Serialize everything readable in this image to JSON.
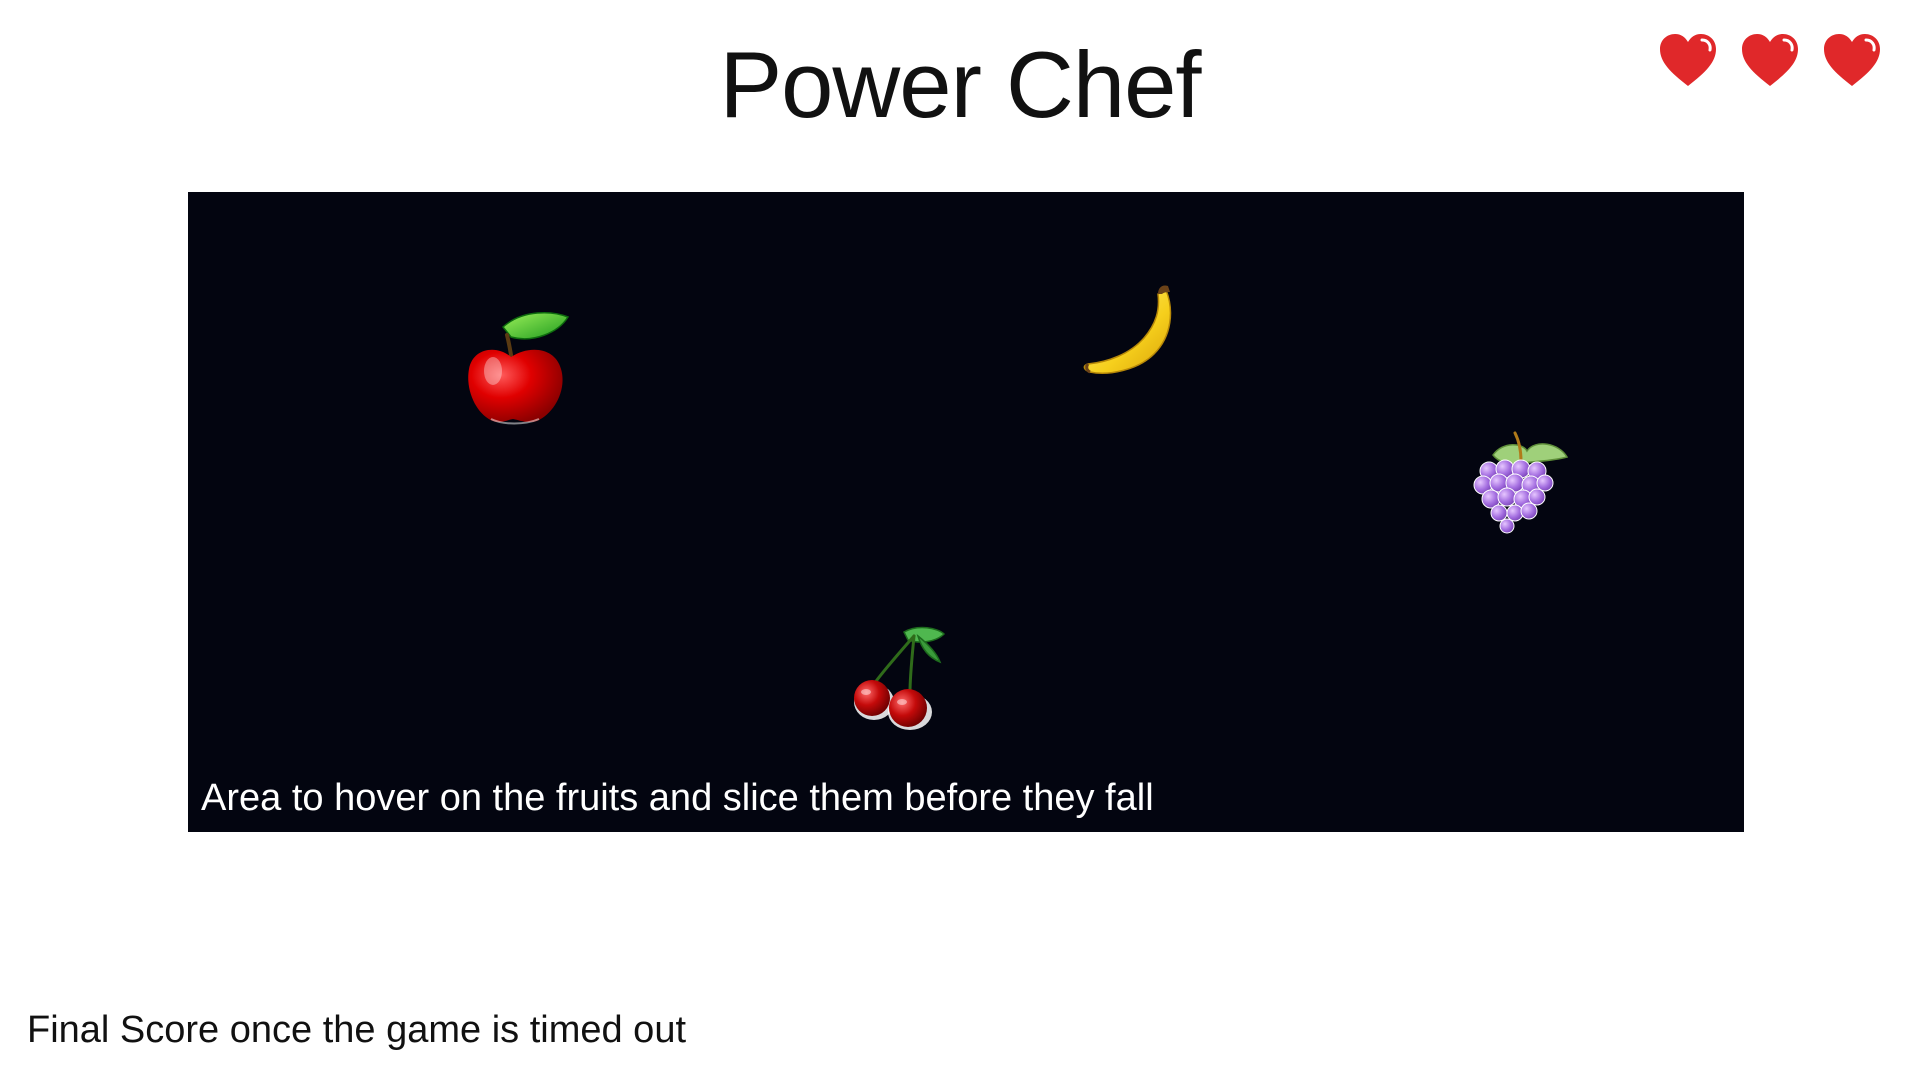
{
  "header": {
    "title": "Power Chef",
    "lives": {
      "remaining": 3,
      "max": 3,
      "icon": "heart-icon",
      "color": "#e0282a"
    }
  },
  "game_board": {
    "background_color": "#030510",
    "hint": "Area to hover on the fruits and slice them before they fall",
    "fruits": [
      {
        "name": "apple",
        "icon": "apple-icon"
      },
      {
        "name": "banana",
        "icon": "banana-icon"
      },
      {
        "name": "grapes",
        "icon": "grapes-icon"
      },
      {
        "name": "cherries",
        "icon": "cherries-icon"
      }
    ]
  },
  "footer": {
    "final_score_note": "Final Score once the game is timed out"
  }
}
